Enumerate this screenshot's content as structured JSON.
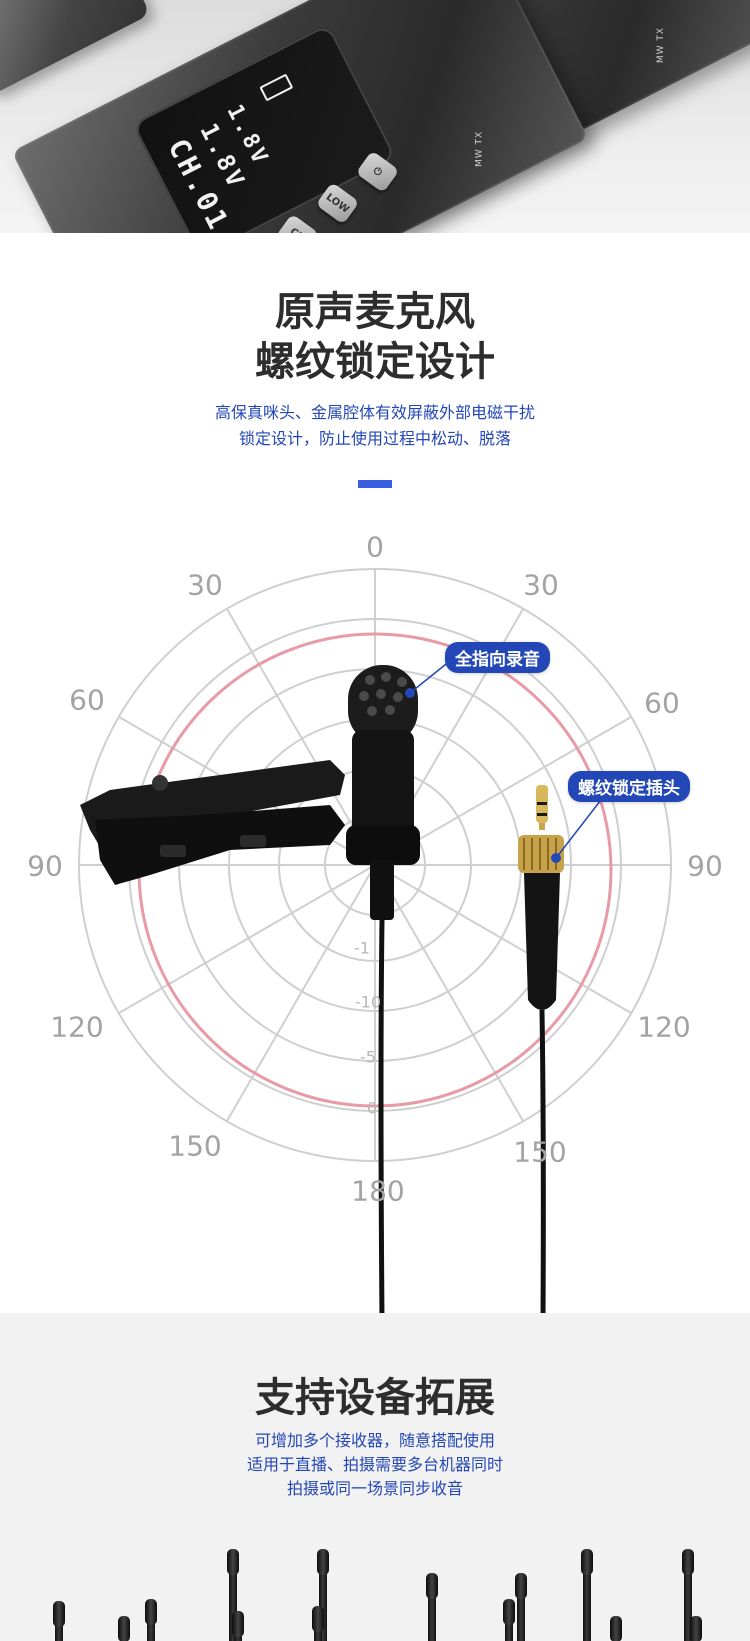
{
  "hero": {
    "lcd_line1": "1.8V",
    "lcd_line2": "1.8V",
    "lcd_line3": "CH.01",
    "btn_ch": "CH",
    "btn_low": "LOW",
    "btn_power_icon": "power-icon",
    "device_label": "MW TX"
  },
  "section_mic": {
    "title_line1": "原声麦克风",
    "title_line2": "螺纹锁定设计",
    "subtitle_line1": "高保真咪头、金属腔体有效屏蔽外部电磁干扰",
    "subtitle_line2": "锁定设计，防止使用过程中松动、脱落",
    "accent_color": "#3a5fe0"
  },
  "polar_chart": {
    "angle_labels": [
      "0",
      "30",
      "30",
      "60",
      "60",
      "90",
      "90",
      "120",
      "120",
      "150",
      "150",
      "180"
    ],
    "db_labels": [
      "-1",
      "-10",
      "-5",
      "0"
    ],
    "callout_omni": "全指向录音",
    "callout_plug": "螺纹锁定插头",
    "curve_color": "#e89aa6",
    "grid_color": "#c9c9c9"
  },
  "section_expand": {
    "title": "支持设备拓展",
    "subtitle_line1": "可增加多个接收器，随意搭配使用",
    "subtitle_line2": "适用于直播、拍摄需要多台机器同时",
    "subtitle_line3": "拍摄或同一场景同步收音"
  }
}
